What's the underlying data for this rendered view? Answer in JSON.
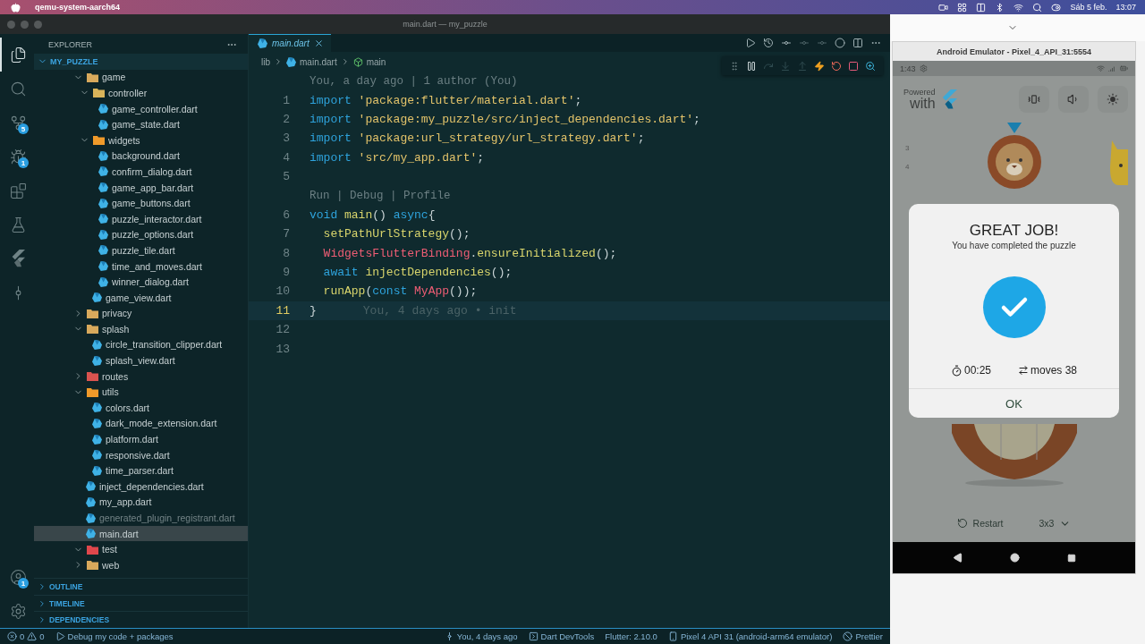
{
  "menubar": {
    "app": "qemu-system-aarch64",
    "date": "Sáb 5 feb.",
    "time": "13:07"
  },
  "window": {
    "title": "main.dart — my_puzzle"
  },
  "activity_bar": [
    {
      "kind": "explorer",
      "selected": true
    },
    {
      "kind": "search",
      "selected": false
    },
    {
      "kind": "source-control",
      "selected": false,
      "badge": "5"
    },
    {
      "kind": "run-debug",
      "selected": false,
      "badge": "1"
    },
    {
      "kind": "extensions",
      "selected": false
    },
    {
      "kind": "testing",
      "selected": false
    },
    {
      "kind": "flutter",
      "selected": false
    },
    {
      "kind": "git-graph",
      "selected": false
    }
  ],
  "activity_bottom": [
    {
      "kind": "account",
      "badge": "1"
    },
    {
      "kind": "settings"
    }
  ],
  "sidebar": {
    "title": "EXPLORER",
    "root": {
      "name": "MY_PUZZLE",
      "expanded": true
    },
    "tree": [
      {
        "kind": "folder",
        "name": "game",
        "expanded": true,
        "selected": false,
        "ignored": false,
        "color": "#d8a95c",
        "children": [
          {
            "kind": "folder",
            "name": "controller",
            "expanded": true,
            "selected": false,
            "ignored": false,
            "color": "#d9b45a",
            "children": [
              {
                "kind": "file",
                "name": "game_controller.dart",
                "selected": false,
                "ignored": false
              },
              {
                "kind": "file",
                "name": "game_state.dart",
                "selected": false,
                "ignored": false
              }
            ]
          },
          {
            "kind": "folder",
            "name": "widgets",
            "expanded": true,
            "selected": false,
            "ignored": false,
            "color": "#f09a2a",
            "children": [
              {
                "kind": "file",
                "name": "background.dart",
                "selected": false,
                "ignored": false
              },
              {
                "kind": "file",
                "name": "confirm_dialog.dart",
                "selected": false,
                "ignored": false
              },
              {
                "kind": "file",
                "name": "game_app_bar.dart",
                "selected": false,
                "ignored": false
              },
              {
                "kind": "file",
                "name": "game_buttons.dart",
                "selected": false,
                "ignored": false
              },
              {
                "kind": "file",
                "name": "puzzle_interactor.dart",
                "selected": false,
                "ignored": false
              },
              {
                "kind": "file",
                "name": "puzzle_options.dart",
                "selected": false,
                "ignored": false
              },
              {
                "kind": "file",
                "name": "puzzle_tile.dart",
                "selected": false,
                "ignored": false
              },
              {
                "kind": "file",
                "name": "time_and_moves.dart",
                "selected": false,
                "ignored": false
              },
              {
                "kind": "file",
                "name": "winner_dialog.dart",
                "selected": false,
                "ignored": false
              }
            ]
          },
          {
            "kind": "file",
            "name": "game_view.dart",
            "selected": false,
            "ignored": false
          }
        ]
      },
      {
        "kind": "folder",
        "name": "privacy",
        "expanded": false,
        "selected": false,
        "ignored": false,
        "color": "#d8a95c"
      },
      {
        "kind": "folder",
        "name": "splash",
        "expanded": true,
        "selected": false,
        "ignored": false,
        "color": "#d8a95c",
        "children": [
          {
            "kind": "file",
            "name": "circle_transition_clipper.dart",
            "selected": false,
            "ignored": false
          },
          {
            "kind": "file",
            "name": "splash_view.dart",
            "selected": false,
            "ignored": false
          }
        ]
      },
      {
        "kind": "folder",
        "name": "routes",
        "expanded": false,
        "selected": false,
        "ignored": false,
        "color": "#d9534f"
      },
      {
        "kind": "folder",
        "name": "utils",
        "expanded": true,
        "selected": false,
        "ignored": false,
        "color": "#f09a2a",
        "children": [
          {
            "kind": "file",
            "name": "colors.dart",
            "selected": false,
            "ignored": false
          },
          {
            "kind": "file",
            "name": "dark_mode_extension.dart",
            "selected": false,
            "ignored": false
          },
          {
            "kind": "file",
            "name": "platform.dart",
            "selected": false,
            "ignored": false
          },
          {
            "kind": "file",
            "name": "responsive.dart",
            "selected": false,
            "ignored": false
          },
          {
            "kind": "file",
            "name": "time_parser.dart",
            "selected": false,
            "ignored": false
          }
        ]
      },
      {
        "kind": "file",
        "name": "inject_dependencies.dart",
        "selected": false,
        "ignored": false
      },
      {
        "kind": "file",
        "name": "my_app.dart",
        "selected": false,
        "ignored": false
      },
      {
        "kind": "file",
        "name": "generated_plugin_registrant.dart",
        "selected": false,
        "ignored": true
      },
      {
        "kind": "file",
        "name": "main.dart",
        "selected": true,
        "ignored": false
      },
      {
        "kind": "folder",
        "name": "test",
        "expanded": true,
        "selected": false,
        "ignored": false,
        "color": "#e0474c"
      },
      {
        "kind": "folder",
        "name": "web",
        "expanded": false,
        "selected": false,
        "ignored": false,
        "color": "#d8a95c"
      }
    ],
    "sections": [
      {
        "title": "OUTLINE",
        "expanded": false
      },
      {
        "title": "TIMELINE",
        "expanded": false
      },
      {
        "title": "DEPENDENCIES",
        "expanded": false
      }
    ]
  },
  "editor": {
    "tab": {
      "label": "main.dart",
      "selected": true
    },
    "breadcrumb": [
      {
        "kind": "folder",
        "label": "lib"
      },
      {
        "kind": "file",
        "label": "main.dart"
      },
      {
        "kind": "symbol",
        "label": "main"
      }
    ],
    "debug_toolbar": [
      {
        "kind": "pause",
        "disabled": false
      },
      {
        "kind": "step-over",
        "disabled": true
      },
      {
        "kind": "step-into",
        "disabled": true
      },
      {
        "kind": "step-out",
        "disabled": true
      },
      {
        "kind": "hot-reload",
        "disabled": false
      },
      {
        "kind": "restart",
        "disabled": false
      },
      {
        "kind": "stop",
        "disabled": false
      },
      {
        "kind": "devtools",
        "disabled": false
      }
    ],
    "blame_header": "You, a day ago | 1 author (You)",
    "lines": [
      {
        "number": "1",
        "current": false,
        "tokens": [
          {
            "kind": "keyword",
            "text": "import "
          },
          {
            "kind": "string",
            "text": "'package:flutter/material.dart'"
          },
          {
            "kind": "plain",
            "text": ";"
          }
        ]
      },
      {
        "number": "2",
        "current": false,
        "tokens": [
          {
            "kind": "keyword",
            "text": "import "
          },
          {
            "kind": "string",
            "text": "'package:my_puzzle/src/inject_dependencies.dart'"
          },
          {
            "kind": "plain",
            "text": ";"
          }
        ]
      },
      {
        "number": "3",
        "current": false,
        "tokens": [
          {
            "kind": "keyword",
            "text": "import "
          },
          {
            "kind": "string",
            "text": "'package:url_strategy/url_strategy.dart'"
          },
          {
            "kind": "plain",
            "text": ";"
          }
        ]
      },
      {
        "number": "4",
        "current": false,
        "tokens": [
          {
            "kind": "keyword",
            "text": "import "
          },
          {
            "kind": "string",
            "text": "'src/my_app.dart'"
          },
          {
            "kind": "plain",
            "text": ";"
          }
        ]
      },
      {
        "number": "5",
        "current": false
      },
      {
        "number": "6",
        "current": false,
        "code_lens": "Run | Debug | Profile",
        "tokens": [
          {
            "kind": "keyword",
            "text": "void "
          },
          {
            "kind": "function",
            "text": "main"
          },
          {
            "kind": "plain",
            "text": "() "
          },
          {
            "kind": "keyword",
            "text": "async"
          },
          {
            "kind": "plain",
            "text": "{"
          }
        ]
      },
      {
        "number": "7",
        "current": false,
        "tokens": [
          {
            "kind": "function",
            "text": "  setPathUrlStrategy"
          },
          {
            "kind": "plain",
            "text": "();"
          }
        ]
      },
      {
        "number": "8",
        "current": false,
        "tokens": [
          {
            "kind": "class",
            "text": "  WidgetsFlutterBinding"
          },
          {
            "kind": "plain",
            "text": "."
          },
          {
            "kind": "function",
            "text": "ensureInitialized"
          },
          {
            "kind": "plain",
            "text": "();"
          }
        ]
      },
      {
        "number": "9",
        "current": false,
        "tokens": [
          {
            "kind": "keyword",
            "text": "  await "
          },
          {
            "kind": "function",
            "text": "injectDependencies"
          },
          {
            "kind": "plain",
            "text": "();"
          }
        ]
      },
      {
        "number": "10",
        "current": false,
        "tokens": [
          {
            "kind": "function",
            "text": "  runApp"
          },
          {
            "kind": "plain",
            "text": "("
          },
          {
            "kind": "keyword",
            "text": "const "
          },
          {
            "kind": "class",
            "text": "MyApp"
          },
          {
            "kind": "plain",
            "text": "());"
          }
        ]
      },
      {
        "number": "11",
        "current": true,
        "blame": "You, 4 days ago • init",
        "tokens": [
          {
            "kind": "plain",
            "text": "}"
          }
        ]
      },
      {
        "number": "12",
        "current": false
      },
      {
        "number": "13",
        "current": false
      }
    ]
  },
  "status_bar": {
    "left": [
      {
        "kind": "problems",
        "errors": "0",
        "warnings": "0"
      },
      {
        "kind": "debug",
        "text": "Debug my code + packages"
      }
    ],
    "right": [
      {
        "kind": "blame",
        "text": "You, 4 days ago"
      },
      {
        "kind": "devtools",
        "text": "Dart DevTools"
      },
      {
        "kind": "flutter",
        "text": "Flutter: 2.10.0"
      },
      {
        "kind": "device",
        "text": "Pixel 4 API 31 (android-arm64 emulator)"
      },
      {
        "kind": "prettier",
        "text": "Prettier"
      }
    ]
  },
  "emulator": {
    "title": "Android Emulator - Pixel_4_API_31:5554",
    "time": "1:43",
    "powered": "Powered",
    "with": "with",
    "side_marks": [
      "3",
      "4"
    ],
    "dialog": {
      "title": "GREAT JOB!",
      "subtitle": "You have completed the puzzle",
      "timer": "00:25",
      "moves": "moves 38",
      "ok": "OK"
    },
    "restart": "Restart",
    "size": "3x3"
  }
}
